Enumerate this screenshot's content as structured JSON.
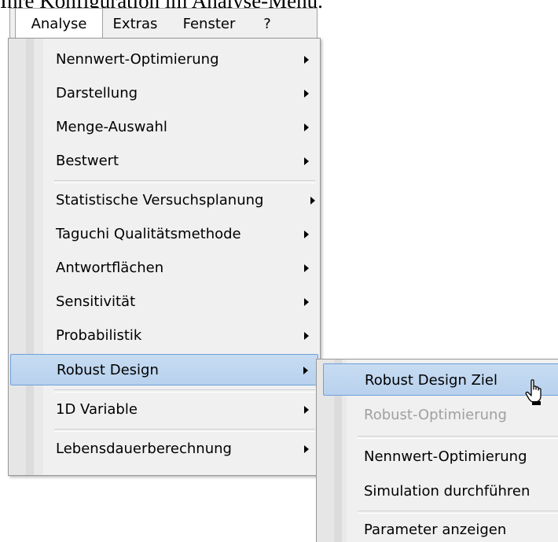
{
  "caption": "Ihre Konfiguration im Analyse-Menü.",
  "menubar": {
    "items": [
      "Analyse",
      "Extras",
      "Fenster",
      "?"
    ],
    "active": "Analyse"
  },
  "menu": {
    "items": [
      {
        "label": "Nennwert-Optimierung",
        "submenu": true
      },
      {
        "label": "Darstellung",
        "submenu": true
      },
      {
        "label": "Menge-Auswahl",
        "submenu": true
      },
      {
        "label": "Bestwert",
        "submenu": true
      },
      {
        "label": "Statistische Versuchsplanung",
        "submenu": true
      },
      {
        "label": "Taguchi Qualitätsmethode",
        "submenu": true
      },
      {
        "label": "Antwortflächen",
        "submenu": true
      },
      {
        "label": "Sensitivität",
        "submenu": true
      },
      {
        "label": "Probabilistik",
        "submenu": true
      },
      {
        "label": "Robust Design",
        "submenu": true,
        "highlighted": true
      },
      {
        "label": "1D Variable",
        "submenu": true
      },
      {
        "label": "Lebensdauerberechnung",
        "submenu": true
      }
    ]
  },
  "submenu": {
    "items": [
      {
        "label": "Robust Design Ziel",
        "highlighted": true
      },
      {
        "label": "Robust-Optimierung",
        "disabled": true
      },
      {
        "label": "Nennwert-Optimierung"
      },
      {
        "label": "Simulation durchführen"
      },
      {
        "label": "Parameter anzeigen"
      }
    ]
  },
  "colors": {
    "highlight": "#c7dcf2",
    "highlight_border": "#6f9fd8",
    "menu_bg": "#f0f0f0",
    "disabled_text": "#a0a0a0"
  },
  "cursor_icon": "hand-pointer-icon"
}
